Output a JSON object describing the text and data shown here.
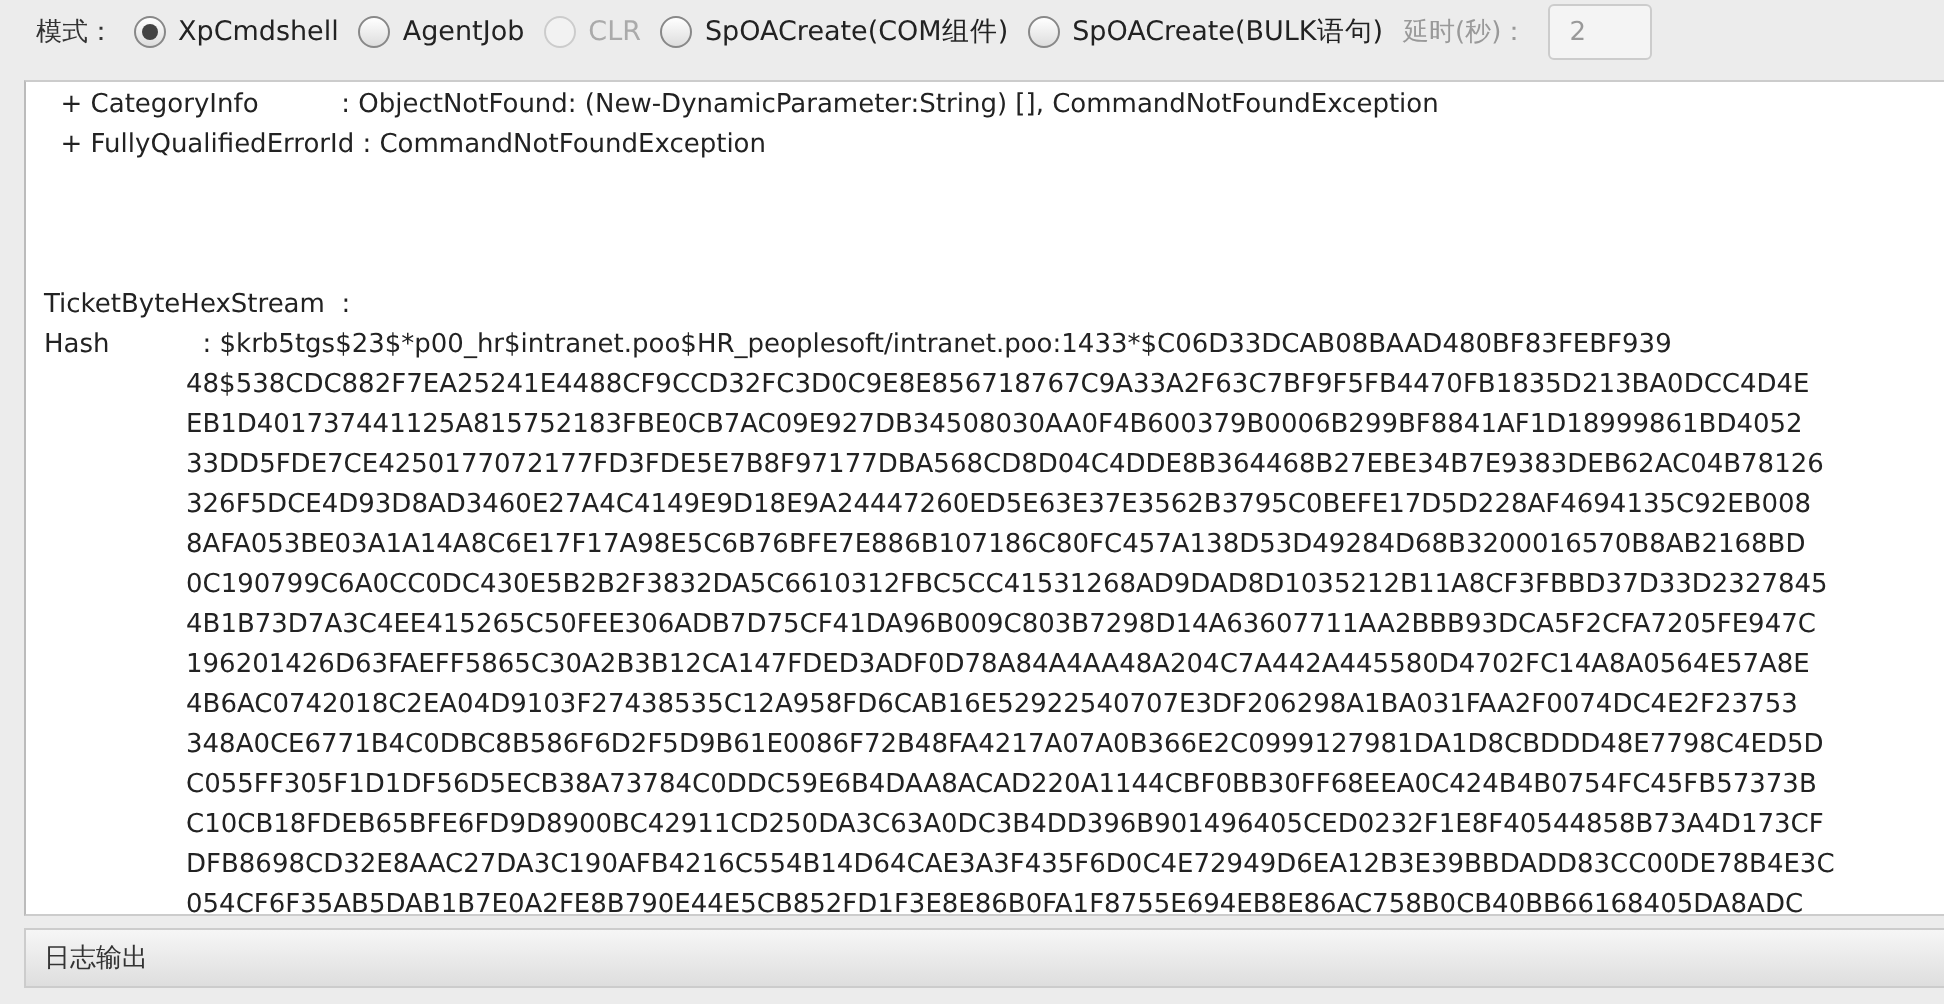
{
  "toolbar": {
    "label": "模式：",
    "modes": [
      {
        "label": "XpCmdshell",
        "selected": true,
        "disabled": false
      },
      {
        "label": "AgentJob",
        "selected": false,
        "disabled": false
      },
      {
        "label": "CLR",
        "selected": false,
        "disabled": true
      },
      {
        "label": "SpOACreate(COM组件)",
        "selected": false,
        "disabled": false
      },
      {
        "label": "SpOACreate(BULK语句)",
        "selected": false,
        "disabled": false
      }
    ],
    "delay_label": "延时(秒)：",
    "delay_value": "2"
  },
  "output": {
    "error_lines": [
      "  + CategoryInfo          : ObjectNotFound: (New-DynamicParameter:String) [], CommandNotFoundException",
      "  + FullyQualifiedErrorId : CommandNotFoundException"
    ],
    "ticket_label": "TicketByteHexStream  :",
    "hash_label": "Hash",
    "hash_lines": [
      "  : $krb5tgs$23$*p00_hr$intranet.poo$HR_peoplesoft/intranet.poo:1433*$C06D33DCAB08BAAD480BF83FEBF939",
      "48$538CDC882F7EA25241E4488CF9CCD32FC3D0C9E8E856718767C9A33A2F63C7BF9F5FB4470FB1835D213BA0DCC4D4E",
      "EB1D401737441125A815752183FBE0CB7AC09E927DB34508030AA0F4B600379B0006B299BF8841AF1D18999861BD4052",
      "33DD5FDE7CE4250177072177FD3FDE5E7B8F97177DBA568CD8D04C4DDE8B364468B27EBE34B7E9383DEB62AC04B78126",
      "326F5DCE4D93D8AD3460E27A4C4149E9D18E9A24447260ED5E63E37E3562B3795C0BEFE17D5D228AF4694135C92EB008",
      "8AFA053BE03A1A14A8C6E17F17A98E5C6B76BFE7E886B107186C80FC457A138D53D49284D68B3200016570B8AB2168BD",
      "0C190799C6A0CC0DC430E5B2B2F3832DA5C6610312FBC5CC41531268AD9DAD8D1035212B11A8CF3FBBD37D33D2327845",
      "4B1B73D7A3C4EE415265C50FEE306ADB7D75CF41DA96B009C803B7298D14A63607711AA2BBB93DCA5F2CFA7205FE947C",
      "196201426D63FAEFF5865C30A2B3B12CA147FDED3ADF0D78A84A4AA48A204C7A442A445580D4702FC14A8A0564E57A8E",
      "4B6AC0742018C2EA04D9103F27438535C12A958FD6CAB16E52922540707E3DF206298A1BA031FAA2F0074DC4E2F23753",
      "348A0CE6771B4C0DBC8B586F6D2F5D9B61E0086F72B48FA4217A07A0B366E2C0999127981DA1D8CBDDD48E7798C4ED5D",
      "C055FF305F1D1DF56D5ECB38A73784C0DDC59E6B4DAA8ACAD220A1144CBF0BB30FF68EEA0C424B4B0754FC45FB57373B",
      "C10CB18FDEB65BFE6FD9D8900BC42911CD250DA3C63A0DC3B4DD396B901496405CED0232F1E8F40544858B73A4D173CF",
      "DFB8698CD32E8AAC27DA3C190AFB4216C554B14D64CAE3A3F435F6D0C4E72949D6EA12B3E39BBDADD83CC00DE78B4E3C",
      "054CF6F35AB5DAB1B7E0A2FE8B790E44E5CB852FD1F3E8E86B0FA1F8755E694EB8E86AC758B0CB40BB66168405DA8ADC"
    ]
  },
  "log_panel": {
    "title": "日志输出"
  }
}
